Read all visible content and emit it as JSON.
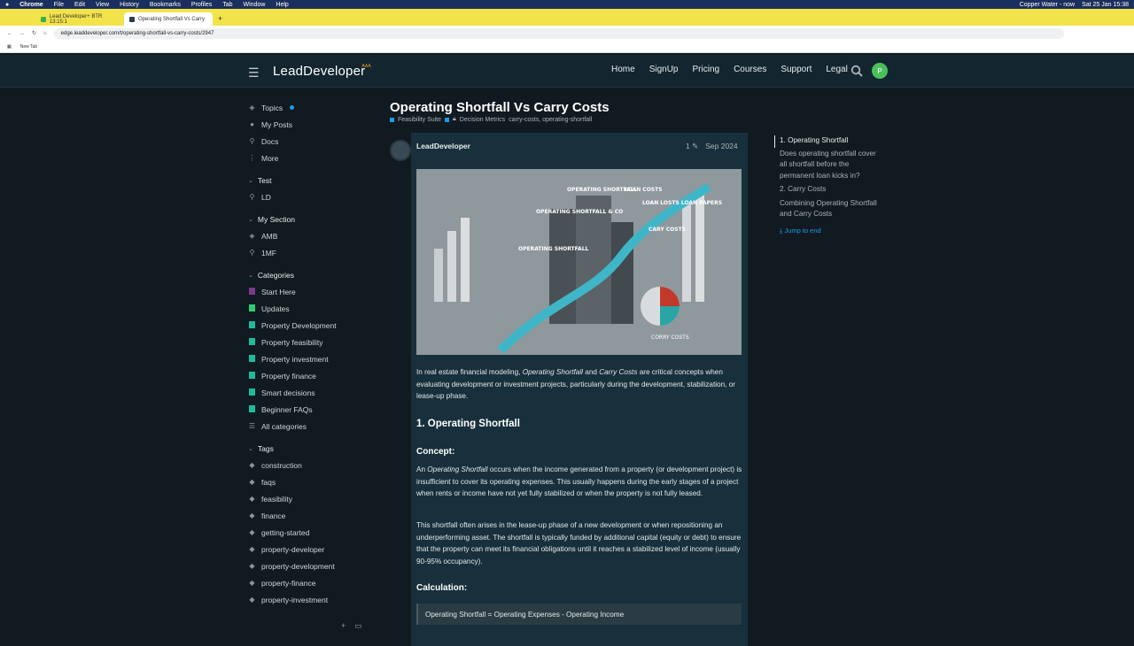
{
  "os_menu": {
    "app": "Chrome",
    "items": [
      "File",
      "Edit",
      "View",
      "History",
      "Bookmarks",
      "Profiles",
      "Tab",
      "Window",
      "Help"
    ],
    "status": "Copper Water - now",
    "clock": "Sat 25 Jan 15:38"
  },
  "browser": {
    "tabs": [
      {
        "label": "Lead Developer+ BTR 13:15:1"
      },
      {
        "label": "Operating Shortfall Vs Carry"
      }
    ],
    "new_tab": "+",
    "url": "edge.leaddeveloper.com/t/operating-shortfall-vs-carry-costs/2947",
    "bookmarks": [
      "New Tab"
    ]
  },
  "header": {
    "logo": "LeadDeveloper",
    "logo_badge": "AAA",
    "nav": [
      "Home",
      "SignUp",
      "Pricing",
      "Courses",
      "Support",
      "Legal"
    ],
    "avatar_letter": "P"
  },
  "sidebar": {
    "main": [
      "Topics",
      "My Posts",
      "Docs",
      "More"
    ],
    "section1_title": "Test",
    "section1": [
      "LD"
    ],
    "section2_title": "My Section",
    "section2": [
      "AMB",
      "1MF"
    ],
    "categories_title": "Categories",
    "categories": [
      {
        "label": "Start Here",
        "color": "#7b3a8c"
      },
      {
        "label": "Updates",
        "color": "#2ecc71"
      },
      {
        "label": "Property Development",
        "color": "#1abc9c"
      },
      {
        "label": "Property feasibility",
        "color": "#1abc9c"
      },
      {
        "label": "Property investment",
        "color": "#1abc9c"
      },
      {
        "label": "Property finance",
        "color": "#1abc9c"
      },
      {
        "label": "Smart decisions",
        "color": "#1abc9c"
      },
      {
        "label": "Beginner FAQs",
        "color": "#1abc9c"
      }
    ],
    "all_categories": "All categories",
    "tags_title": "Tags",
    "tags": [
      "construction",
      "faqs",
      "feasibility",
      "finance",
      "getting-started",
      "property-developer",
      "property-development",
      "property-finance",
      "property-investment"
    ]
  },
  "topic": {
    "title": "Operating Shortfall Vs Carry Costs",
    "category": "Feasibility Suite",
    "subcategory": "Decision Metrics",
    "tags": "carry-costs, operating-shortfall",
    "author": "LeadDeveloper",
    "edits": "1",
    "date": "Sep 2024",
    "image_labels": [
      "OPERATING SHORTFALL",
      "LOAN COSTS",
      "LOAN LOSTS LOAN PAPERS",
      "OPERATING SHORTFALL & CO",
      "CARY COSTS",
      "OPERATING SHORTFALL",
      "CORRY COSTS"
    ],
    "intro_a": "In real estate financial modeling, ",
    "intro_em1": "Operating Shortfall",
    "intro_b": " and ",
    "intro_em2": "Carry Costs",
    "intro_c": " are critical concepts when evaluating development or investment projects, particularly during the development, stabilization, or lease-up phase.",
    "h_operating": "1. Operating Shortfall",
    "h_concept": "Concept:",
    "concept_a": "An ",
    "concept_em": "Operating Shortfall",
    "concept_b": " occurs when the income generated from a property (or development project) is insufficient to cover its operating expenses. This usually happens during the early stages of a project when rents or income have not yet fully stabilized or when the property is not fully leased.",
    "para2": "This shortfall often arises in the lease-up phase of a new development or when repositioning an underperforming asset. The shortfall is typically funded by additional capital (equity or debt) to ensure that the property can meet its financial obligations until it reaches a stabilized level of income (usually 90-95% occupancy).",
    "h_calc": "Calculation:",
    "formula": "Operating Shortfall = Operating Expenses - Operating Income"
  },
  "toc": {
    "items": [
      "1. Operating Shortfall",
      "Does operating shortfall cover all shortfall before the permanent loan kicks in?",
      "2. Carry Costs",
      "Combining Operating Shortfall and Carry Costs"
    ],
    "jump": "Jump to end"
  }
}
